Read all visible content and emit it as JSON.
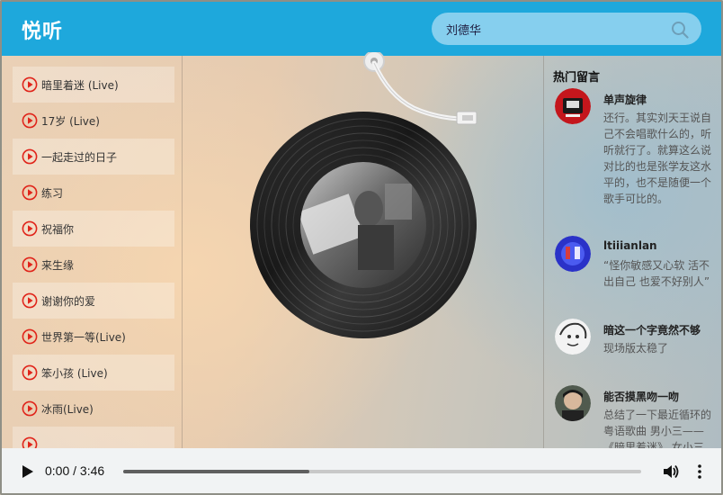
{
  "app": {
    "title": "悦听"
  },
  "search": {
    "value": "刘德华",
    "icon": "search-icon"
  },
  "songs": [
    {
      "name": "暗里着迷 (Live)"
    },
    {
      "name": "17岁 (Live)"
    },
    {
      "name": "一起走过的日子"
    },
    {
      "name": "练习"
    },
    {
      "name": "祝福你"
    },
    {
      "name": "来生缘"
    },
    {
      "name": "谢谢你的爱"
    },
    {
      "name": "世界第一等(Live)"
    },
    {
      "name": "笨小孩 (Live)"
    },
    {
      "name": "冰雨(Live)"
    },
    {
      "name": ""
    }
  ],
  "comments": {
    "title": "热门留言",
    "items": [
      {
        "user": "单声旋律",
        "text": "还行。其实刘天王说自己不会唱歌什么的，听听就行了。就算这么说对比的也是张学友这水平的，也不是随便一个歌手可比的。"
      },
      {
        "user": "ltiiianlan",
        "text": "“怪你敏感又心软 活不出自己 也爱不好别人”"
      },
      {
        "user": "暗这一个字竟然不够",
        "text": "现场版太稳了"
      },
      {
        "user": "能否摸黑吻一吻",
        "text": "总结了一下最近循环的粤语歌曲 男小三——《暗里着迷》 女小三"
      }
    ]
  },
  "player": {
    "current_time": "0:00",
    "duration": "3:46",
    "time_display": "0:00 / 3:46",
    "progress": 0.36
  },
  "colors": {
    "header": "#1ea8dc",
    "search_bg": "#86cfee",
    "play_icon": "#e0251b",
    "player_bg": "#f1f3f4"
  }
}
